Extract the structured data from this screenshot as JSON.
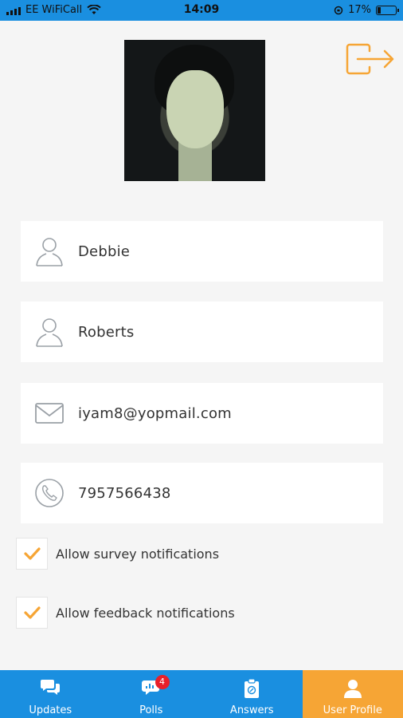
{
  "status_bar": {
    "carrier": "EE WiFiCall",
    "time": "14:09",
    "battery": "17%",
    "battery_level": 0.17
  },
  "profile": {
    "first_name": "Debbie",
    "last_name": "Roberts",
    "email": "iyam8@yopmail.com",
    "phone": "7957566438"
  },
  "notifications": [
    {
      "label": "Allow survey notifications",
      "checked": true
    },
    {
      "label": "Allow feedback notifications",
      "checked": true
    }
  ],
  "tabs": [
    {
      "label": "Updates",
      "icon": "chat-bubbles-icon"
    },
    {
      "label": "Polls",
      "icon": "polls-icon",
      "badge": "4"
    },
    {
      "label": "Answers",
      "icon": "clipboard-icon"
    },
    {
      "label": "User Profile",
      "icon": "user-icon",
      "active": true
    }
  ],
  "colors": {
    "primary": "#1a8fe0",
    "accent": "#f6a535",
    "badge": "#e8202a",
    "background": "#f5f5f5"
  }
}
